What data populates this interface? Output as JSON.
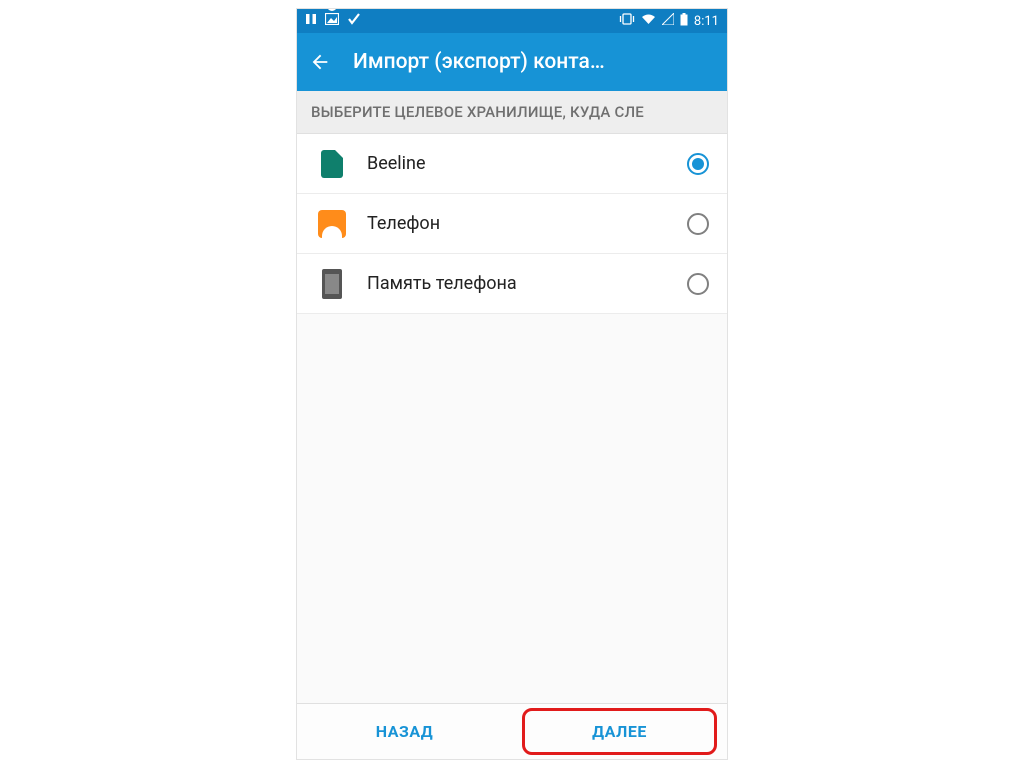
{
  "status": {
    "time": "8:11"
  },
  "appbar": {
    "title": "Импорт (экспорт) конта…"
  },
  "section": {
    "header": "ВЫБЕРИТЕ ЦЕЛЕВОЕ ХРАНИЛИЩЕ, КУДА СЛЕ"
  },
  "storage": {
    "items": [
      {
        "label": "Beeline",
        "icon": "sim",
        "selected": true
      },
      {
        "label": "Телефон",
        "icon": "contact",
        "selected": false
      },
      {
        "label": "Память телефона",
        "icon": "phone-storage",
        "selected": false
      }
    ]
  },
  "footer": {
    "back": "НАЗАД",
    "next": "ДАЛЕЕ"
  }
}
